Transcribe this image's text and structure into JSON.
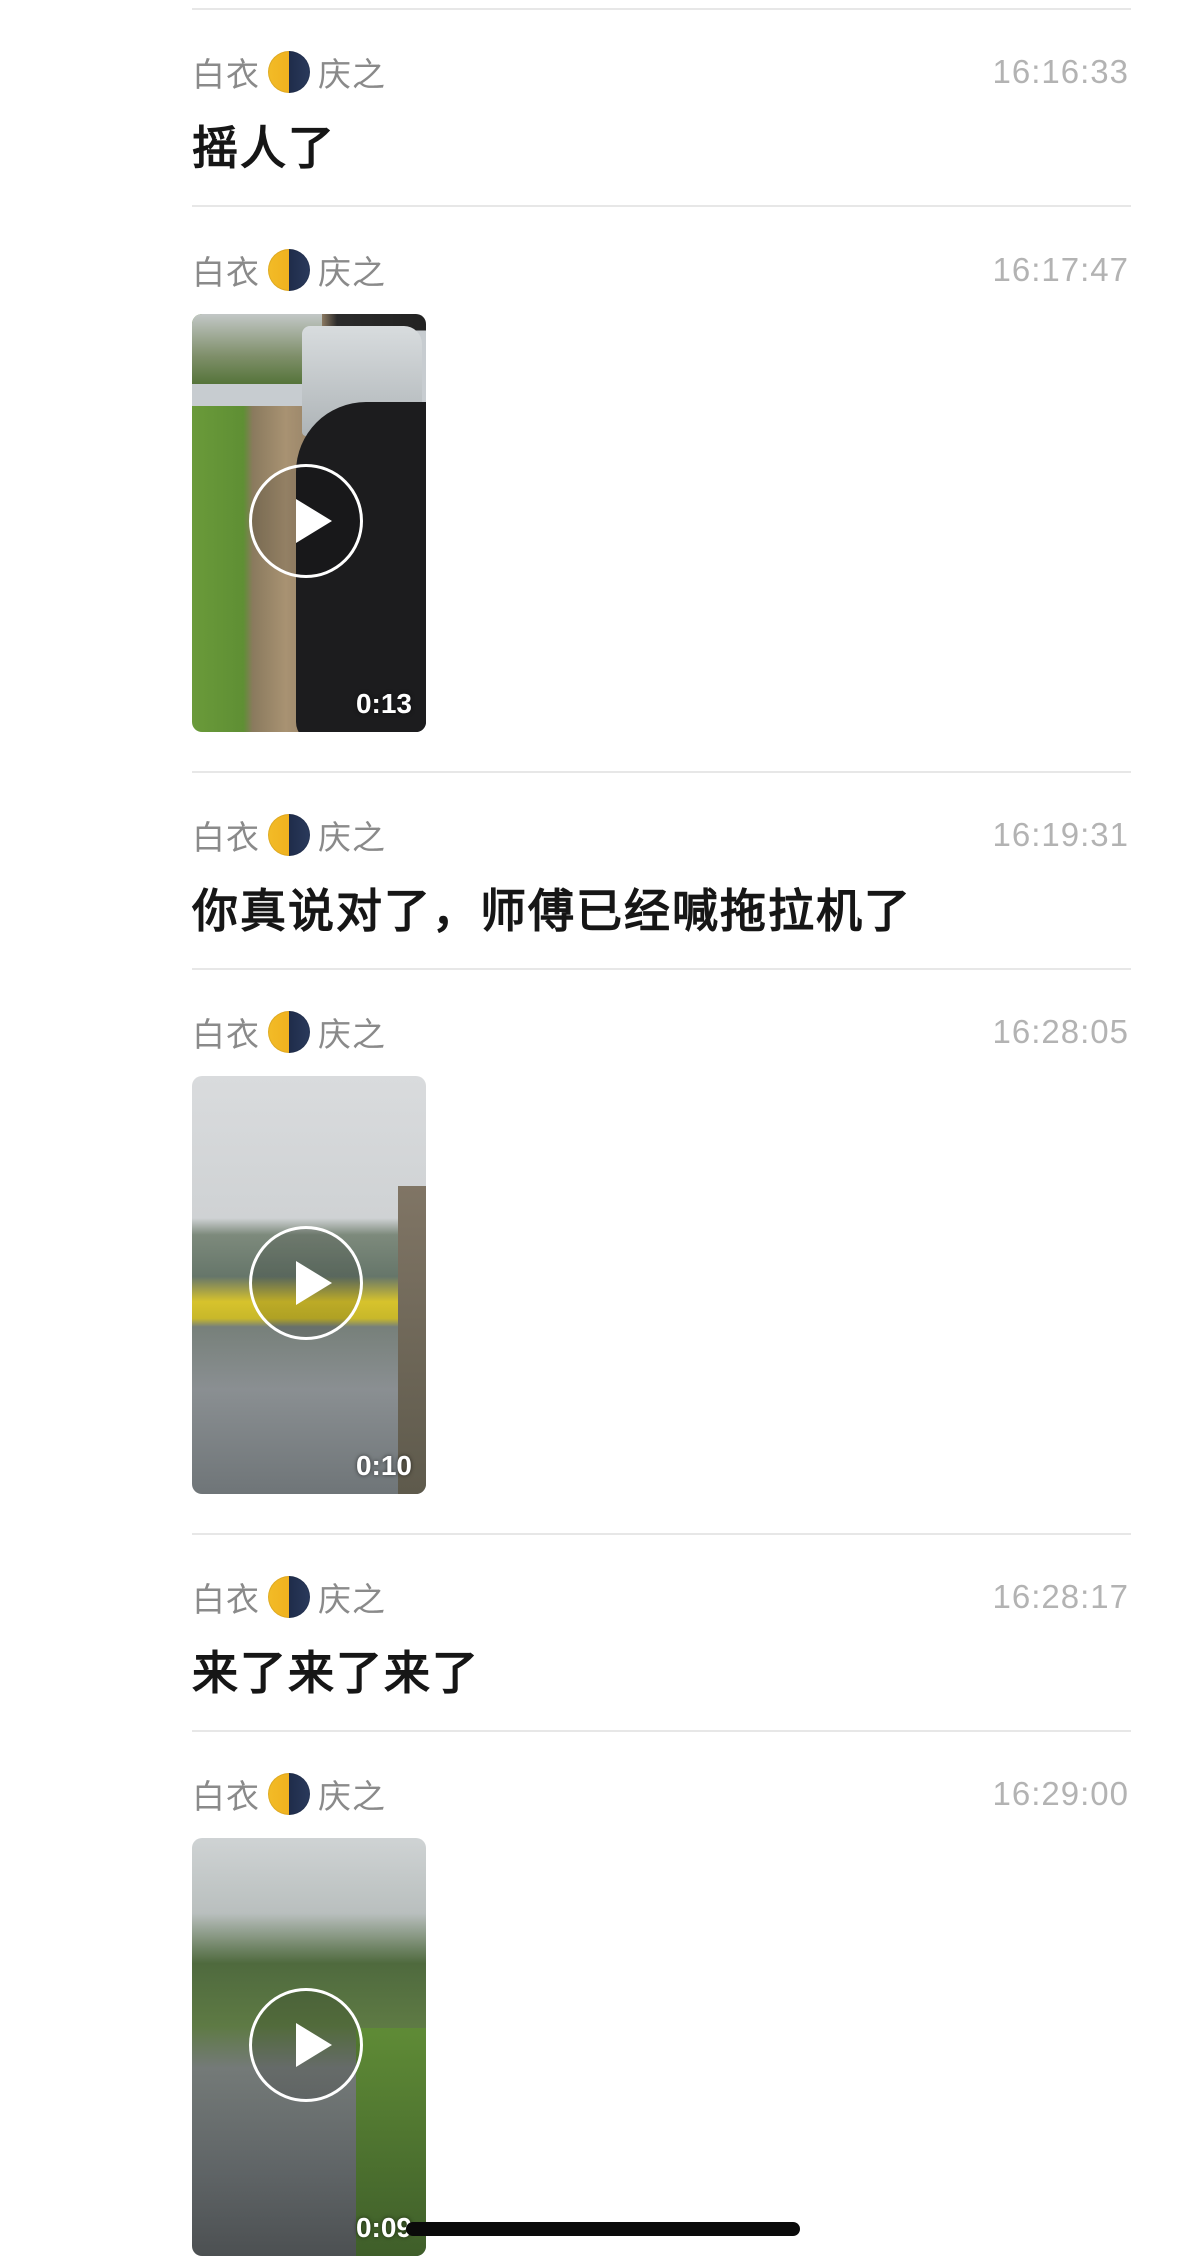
{
  "messages": [
    {
      "sender_left": "白衣",
      "sender_right": "庆之",
      "time": "16:16:33",
      "type": "text",
      "text": "摇人了"
    },
    {
      "sender_left": "白衣",
      "sender_right": "庆之",
      "time": "16:17:47",
      "type": "video",
      "duration": "0:13"
    },
    {
      "sender_left": "白衣",
      "sender_right": "庆之",
      "time": "16:19:31",
      "type": "text",
      "text": "你真说对了，师傅已经喊拖拉机了"
    },
    {
      "sender_left": "白衣",
      "sender_right": "庆之",
      "time": "16:28:05",
      "type": "video",
      "duration": "0:10"
    },
    {
      "sender_left": "白衣",
      "sender_right": "庆之",
      "time": "16:28:17",
      "type": "text",
      "text": "来了来了来了"
    },
    {
      "sender_left": "白衣",
      "sender_right": "庆之",
      "time": "16:29:00",
      "type": "video",
      "duration": "0:09"
    }
  ],
  "icons": {
    "sender_emoji": "moon-emoji-icon",
    "video_play": "play-icon"
  },
  "colors": {
    "sender_text": "#8a8a8a",
    "time_text": "#b3b3b3",
    "message_text": "#161616",
    "divider": "#e7e7e7",
    "background": "#ffffff"
  }
}
